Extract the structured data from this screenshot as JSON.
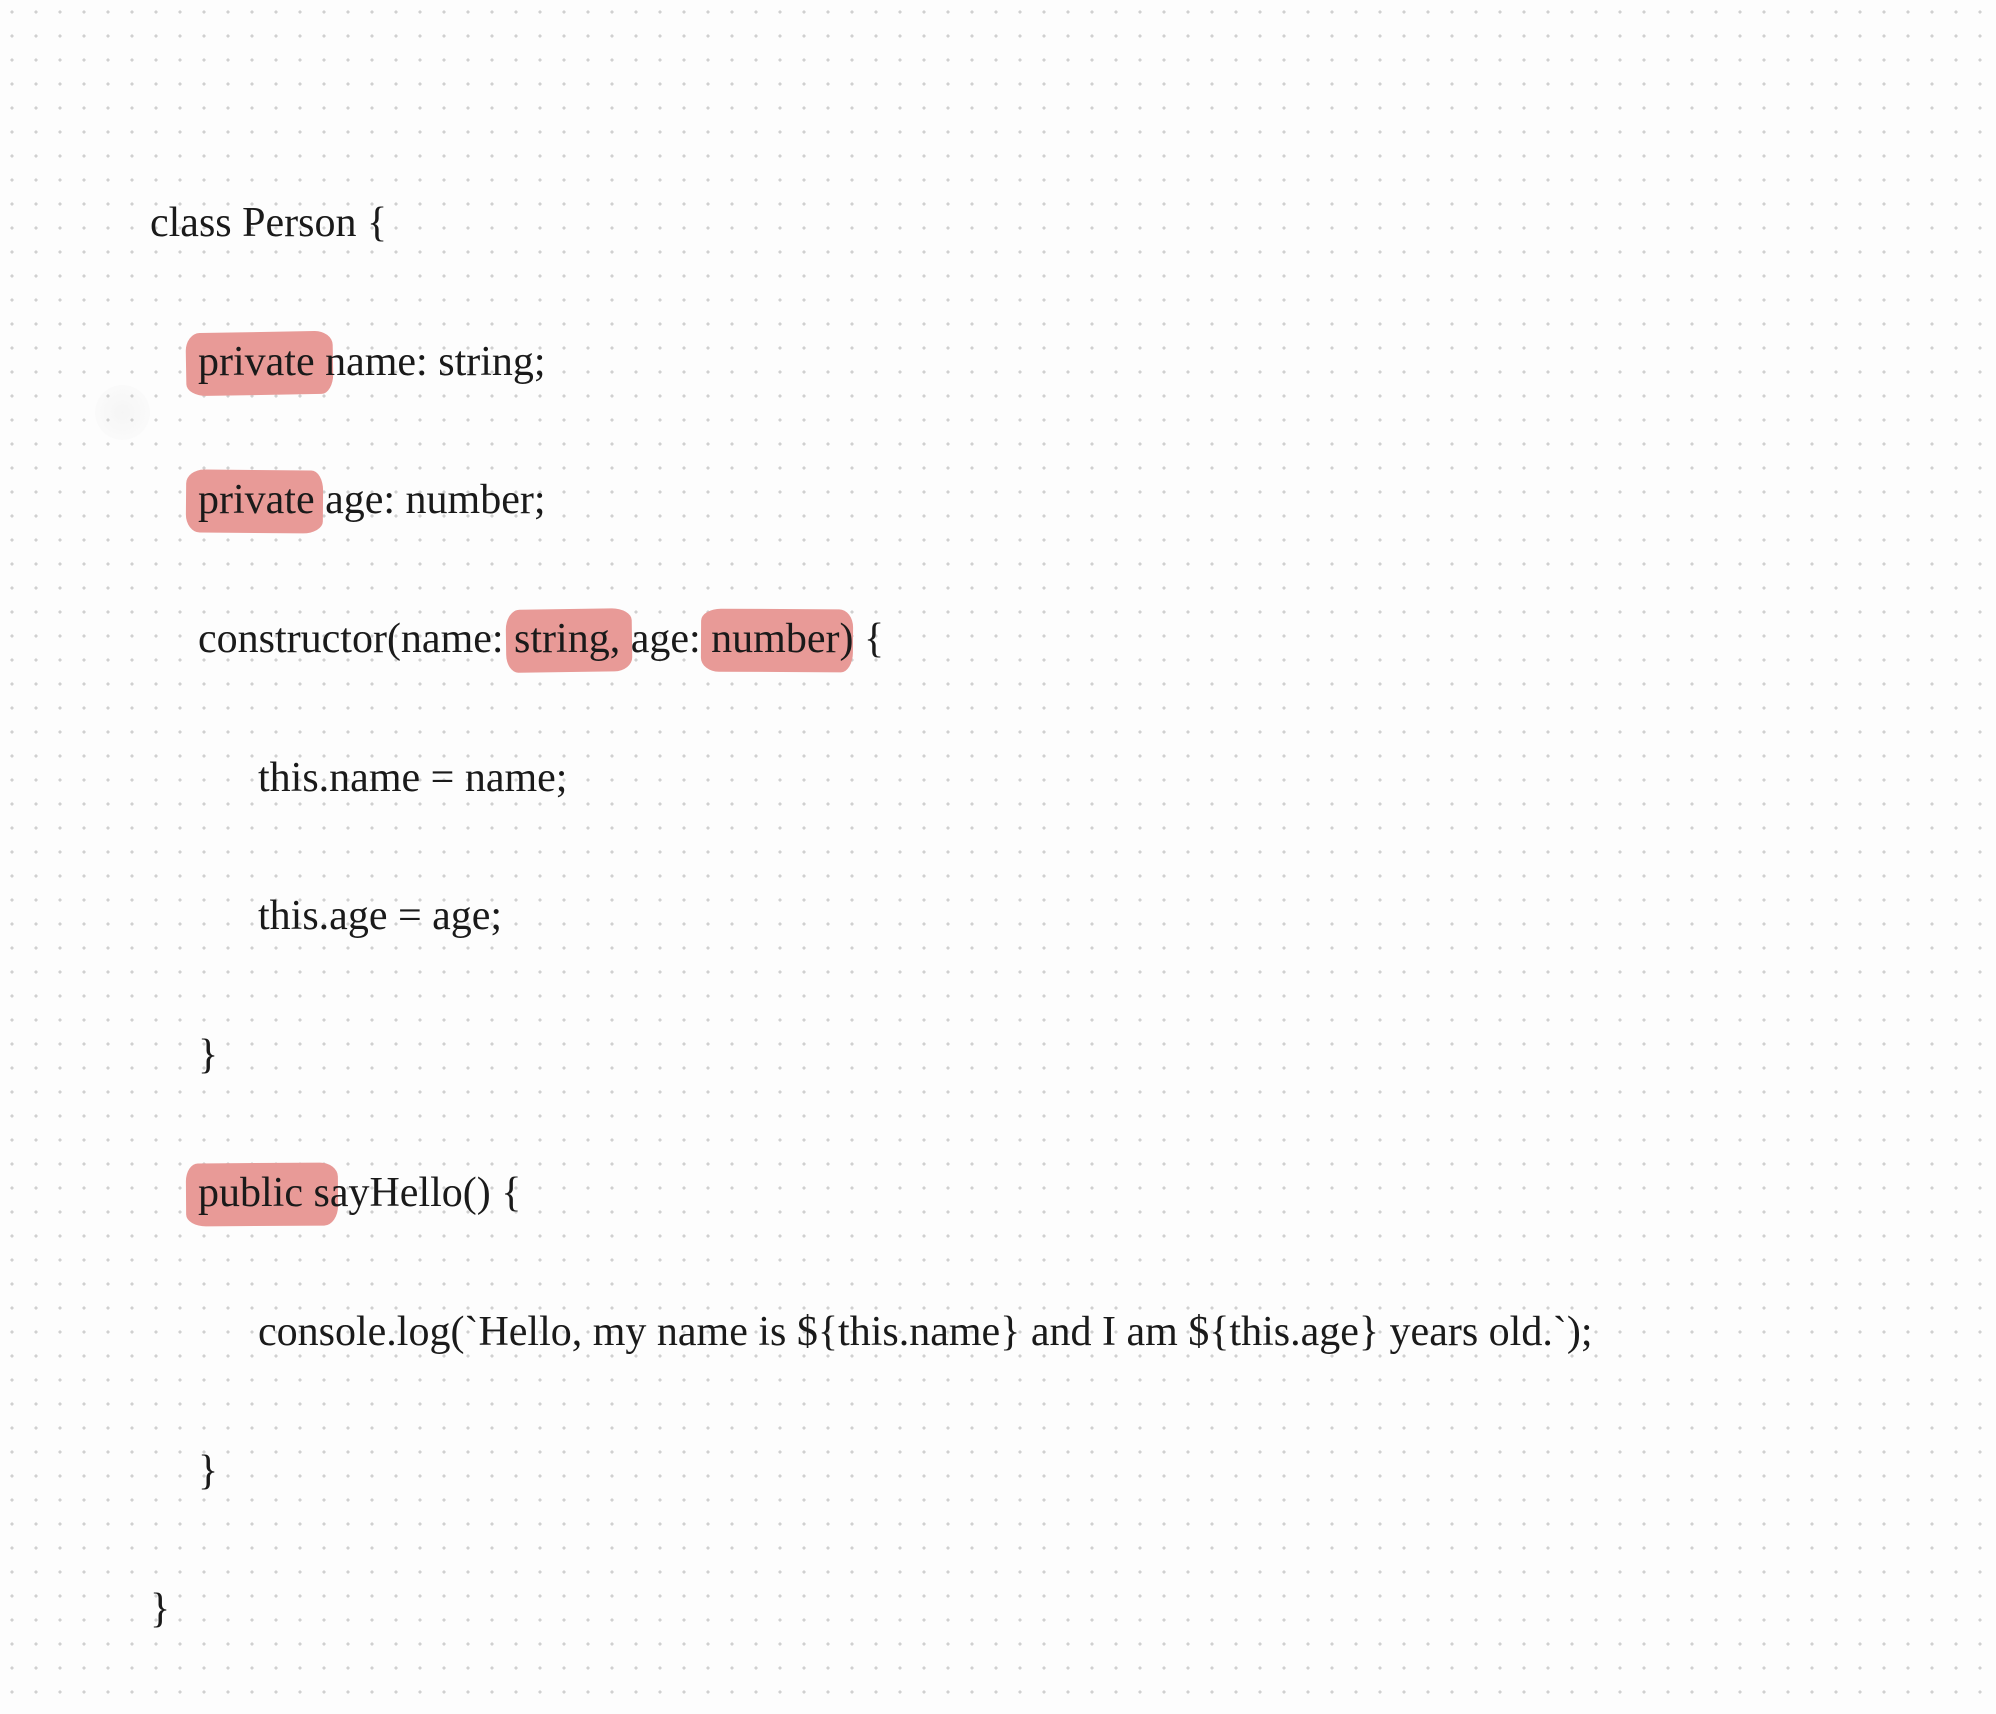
{
  "code": {
    "line1_pre": "class Person {",
    "line2_hl": "private ",
    "line2_post": "name: string;",
    "line3_hl": "private",
    "line3_post": " age: number;",
    "line4_pre": "constructor(name: ",
    "line4_hl1": "string,",
    "line4_mid": " age: ",
    "line4_hl2": "number",
    "line4_post": ") {",
    "line5": "this.name = name;",
    "line6": "this.age = age;",
    "line7": "}",
    "line8_hl": "public s",
    "line8_post": "ayHello() {",
    "line9": "console.log(`Hello, my name is ${this.name} and I am ${this.age} years old.`);",
    "line10": "}",
    "line11": "}"
  },
  "highlight_color": "#e89a97"
}
